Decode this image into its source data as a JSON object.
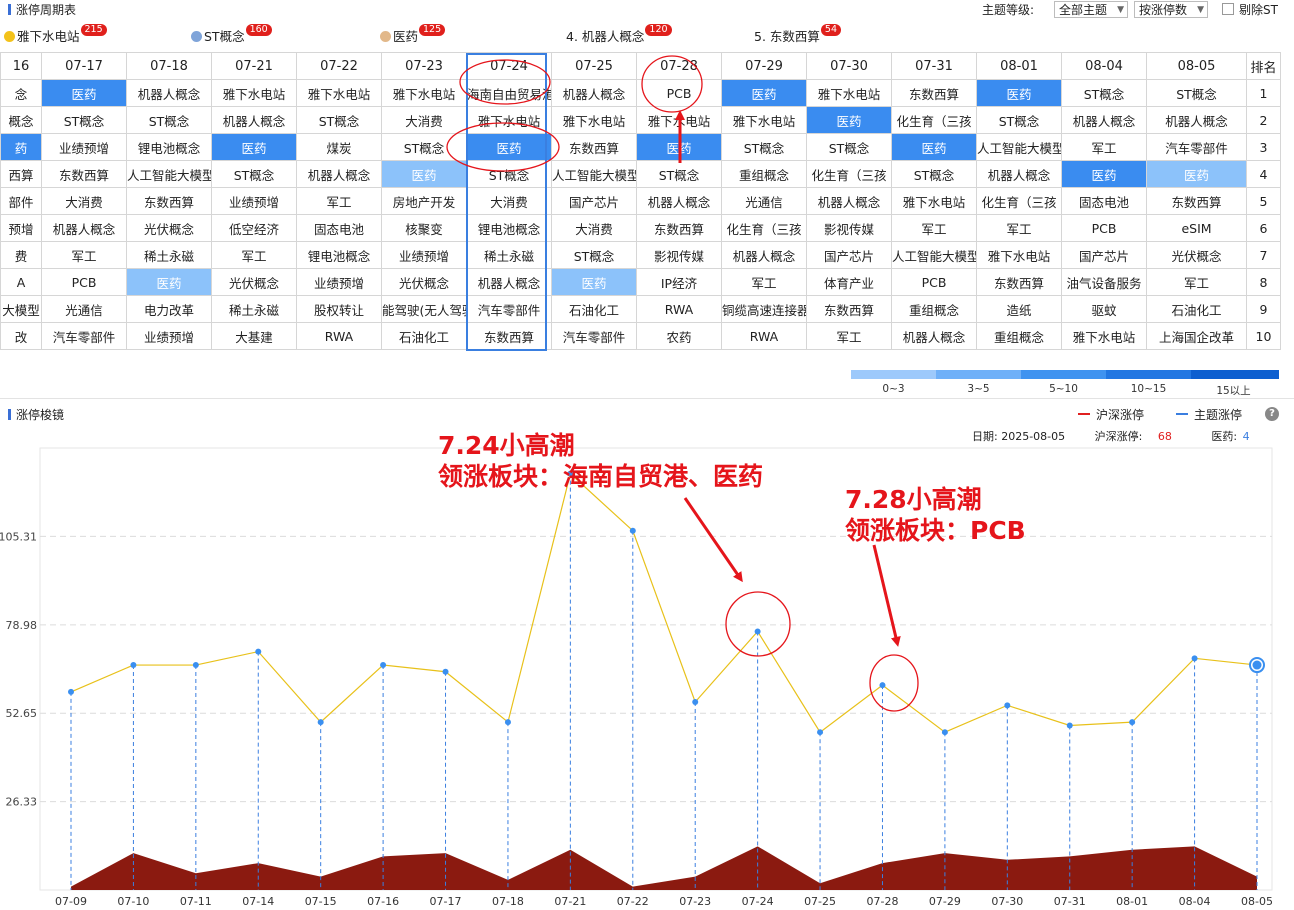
{
  "top": {
    "title": "涨停周期表",
    "theme_level_label": "主题等级:",
    "theme_level_value": "全部主题",
    "sort_value": "按涨停数",
    "exclude_st_label": "剔除ST"
  },
  "themes": [
    {
      "label": "雅下水电站",
      "count": "215",
      "icon_color": "#f3c21a"
    },
    {
      "label": "ST概念",
      "count": "160",
      "icon_color": "#7fa4d9"
    },
    {
      "label": "医药",
      "count": "125",
      "icon_color": "#e2b88a"
    },
    {
      "label": "4. 机器人概念",
      "count": "120"
    },
    {
      "label": "5. 东数西算",
      "count": "54"
    }
  ],
  "table": {
    "dates": [
      "16",
      "07-17",
      "07-18",
      "07-21",
      "07-22",
      "07-23",
      "07-24",
      "07-25",
      "07-28",
      "07-29",
      "07-30",
      "07-31",
      "08-01",
      "08-04",
      "08-05"
    ],
    "rank_header": "排名",
    "rows": [
      [
        "念",
        "医药",
        "机器人概念",
        "雅下水电站",
        "雅下水电站",
        "雅下水电站",
        "海南自由贸易港",
        "机器人概念",
        "PCB",
        "医药",
        "雅下水电站",
        "东数西算",
        "医药",
        "ST概念",
        "ST概念"
      ],
      [
        "概念",
        "ST概念",
        "ST概念",
        "机器人概念",
        "ST概念",
        "大消费",
        "雅下水电站",
        "雅下水电站",
        "雅下水电站",
        "雅下水电站",
        "医药",
        "化生育（三孩",
        "ST概念",
        "机器人概念",
        "机器人概念"
      ],
      [
        "药",
        "业绩预增",
        "锂电池概念",
        "医药",
        "煤炭",
        "ST概念",
        "医药",
        "东数西算",
        "医药",
        "ST概念",
        "ST概念",
        "医药",
        "人工智能大模型",
        "军工",
        "汽车零部件"
      ],
      [
        "西算",
        "东数西算",
        "人工智能大模型",
        "ST概念",
        "机器人概念",
        "医药",
        "ST概念",
        "人工智能大模型",
        "ST概念",
        "重组概念",
        "化生育（三孩",
        "ST概念",
        "机器人概念",
        "医药",
        "医药"
      ],
      [
        "部件",
        "大消费",
        "东数西算",
        "业绩预增",
        "军工",
        "房地产开发",
        "大消费",
        "国产芯片",
        "机器人概念",
        "光通信",
        "机器人概念",
        "雅下水电站",
        "化生育（三孩",
        "固态电池",
        "东数西算"
      ],
      [
        "预增",
        "机器人概念",
        "光伏概念",
        "低空经济",
        "固态电池",
        "核聚变",
        "锂电池概念",
        "大消费",
        "东数西算",
        "化生育（三孩",
        "影视传媒",
        "军工",
        "军工",
        "PCB",
        "eSIM"
      ],
      [
        "费",
        "军工",
        "稀土永磁",
        "军工",
        "锂电池概念",
        "业绩预增",
        "稀土永磁",
        "ST概念",
        "影视传媒",
        "机器人概念",
        "国产芯片",
        "人工智能大模型",
        "雅下水电站",
        "国产芯片",
        "光伏概念"
      ],
      [
        "A",
        "PCB",
        "医药",
        "光伏概念",
        "业绩预增",
        "光伏概念",
        "机器人概念",
        "医药",
        "IP经济",
        "军工",
        "体育产业",
        "PCB",
        "东数西算",
        "油气设备服务",
        "军工"
      ],
      [
        "大模型",
        "光通信",
        "电力改革",
        "稀土永磁",
        "股权转让",
        "能驾驶(无人驾驶",
        "汽车零部件",
        "石油化工",
        "RWA",
        "铜缆高速连接器",
        "东数西算",
        "重组概念",
        "造纸",
        "驱蚊",
        "石油化工"
      ],
      [
        "改",
        "汽车零部件",
        "业绩预增",
        "大基建",
        "RWA",
        "石油化工",
        "东数西算",
        "汽车零部件",
        "农药",
        "RWA",
        "军工",
        "机器人概念",
        "重组概念",
        "雅下水电站",
        "上海国企改革"
      ]
    ],
    "ranks": [
      "1",
      "2",
      "3",
      "4",
      "5",
      "6",
      "7",
      "8",
      "9",
      "10"
    ]
  },
  "legend": {
    "labels": [
      "0~3",
      "3~5",
      "5~10",
      "10~15",
      "15以上"
    ],
    "colors": [
      "#9dc9fb",
      "#6fb0f8",
      "#3f93f0",
      "#2277e2",
      "#0d5fd0"
    ]
  },
  "section2": {
    "title": "涨停梭镜",
    "legend_sh": "沪深涨停",
    "legend_theme": "主题涨停",
    "sh_color": "#e02020",
    "theme_color": "#3a7ee0",
    "info_date_label": "日期:",
    "info_date": "2025-08-05",
    "info_sh_label": "沪深涨停:",
    "info_sh": "68",
    "info_theme_label": "医药:",
    "info_theme": "4",
    "help": "?"
  },
  "annotations": {
    "a1_line1": "7.24小高潮",
    "a1_line2": "领涨板块：海南自贸港、医药",
    "a2_line1": "7.28小高潮",
    "a2_line2": "领涨板块：PCB"
  },
  "chart_data": {
    "type": "line",
    "x": [
      "07-09",
      "07-10",
      "07-11",
      "07-14",
      "07-15",
      "07-16",
      "07-17",
      "07-18",
      "07-21",
      "07-22",
      "07-23",
      "07-24",
      "07-25",
      "07-28",
      "07-29",
      "07-30",
      "07-31",
      "08-01",
      "08-04",
      "08-05"
    ],
    "yticks": [
      "26.33",
      "52.65",
      "78.98",
      "105.31"
    ],
    "ylim": [
      0,
      131.64
    ],
    "series": [
      {
        "name": "沪深涨停",
        "type": "line",
        "color": "#e8c11a",
        "values": [
          59,
          67,
          67,
          71,
          50,
          67,
          65,
          50,
          124,
          107,
          56,
          77,
          47,
          61,
          47,
          55,
          49,
          50,
          69,
          67
        ]
      },
      {
        "name": "主题涨停",
        "type": "area",
        "color": "#8b1a10",
        "values": [
          1,
          11,
          5,
          8,
          4,
          10,
          11,
          3,
          12,
          1,
          4,
          13,
          2,
          8,
          11,
          9,
          10,
          12,
          13,
          4
        ]
      }
    ]
  }
}
